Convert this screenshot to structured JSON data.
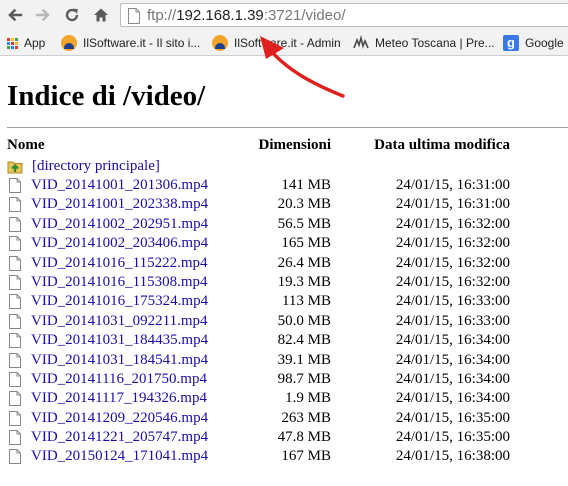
{
  "browser": {
    "url": {
      "scheme": "ftp://",
      "host": "192.168.1.39",
      "rest": ":3721/video/"
    },
    "bookmarks": [
      {
        "label": "App",
        "icon": "apps-grid-icon"
      },
      {
        "label": "IlSoftware.it - Il sito i...",
        "icon": "ilsoftware-icon"
      },
      {
        "label": "IlSoftware.it - Admin",
        "icon": "ilsoftware-icon"
      },
      {
        "label": "Meteo Toscana | Pre...",
        "icon": "meteo-icon"
      },
      {
        "label": "Google",
        "icon": "google-icon"
      }
    ]
  },
  "page": {
    "title": "Indice di /video/",
    "columns": {
      "name": "Nome",
      "size": "Dimensioni",
      "modified": "Data ultima modifica"
    },
    "parent_link": "[directory principale]",
    "files": [
      {
        "name": "VID_20141001_201306.mp4",
        "size": "141 MB",
        "date": "24/01/15, 16:31:00"
      },
      {
        "name": "VID_20141001_202338.mp4",
        "size": "20.3 MB",
        "date": "24/01/15, 16:31:00"
      },
      {
        "name": "VID_20141002_202951.mp4",
        "size": "56.5 MB",
        "date": "24/01/15, 16:32:00"
      },
      {
        "name": "VID_20141002_203406.mp4",
        "size": "165 MB",
        "date": "24/01/15, 16:32:00"
      },
      {
        "name": "VID_20141016_115222.mp4",
        "size": "26.4 MB",
        "date": "24/01/15, 16:32:00"
      },
      {
        "name": "VID_20141016_115308.mp4",
        "size": "19.3 MB",
        "date": "24/01/15, 16:32:00"
      },
      {
        "name": "VID_20141016_175324.mp4",
        "size": "113 MB",
        "date": "24/01/15, 16:33:00"
      },
      {
        "name": "VID_20141031_092211.mp4",
        "size": "50.0 MB",
        "date": "24/01/15, 16:33:00"
      },
      {
        "name": "VID_20141031_184435.mp4",
        "size": "82.4 MB",
        "date": "24/01/15, 16:34:00"
      },
      {
        "name": "VID_20141031_184541.mp4",
        "size": "39.1 MB",
        "date": "24/01/15, 16:34:00"
      },
      {
        "name": "VID_20141116_201750.mp4",
        "size": "98.7 MB",
        "date": "24/01/15, 16:34:00"
      },
      {
        "name": "VID_20141117_194326.mp4",
        "size": "1.9 MB",
        "date": "24/01/15, 16:34:00"
      },
      {
        "name": "VID_20141209_220546.mp4",
        "size": "263 MB",
        "date": "24/01/15, 16:35:00"
      },
      {
        "name": "VID_20141221_205747.mp4",
        "size": "47.8 MB",
        "date": "24/01/15, 16:35:00"
      },
      {
        "name": "VID_20150124_171041.mp4",
        "size": "167 MB",
        "date": "24/01/15, 16:38:00"
      }
    ]
  },
  "colors": {
    "link": "#1a0dab",
    "annotation_arrow": "#e0201c",
    "chrome_bg": "#f2f2f2"
  }
}
